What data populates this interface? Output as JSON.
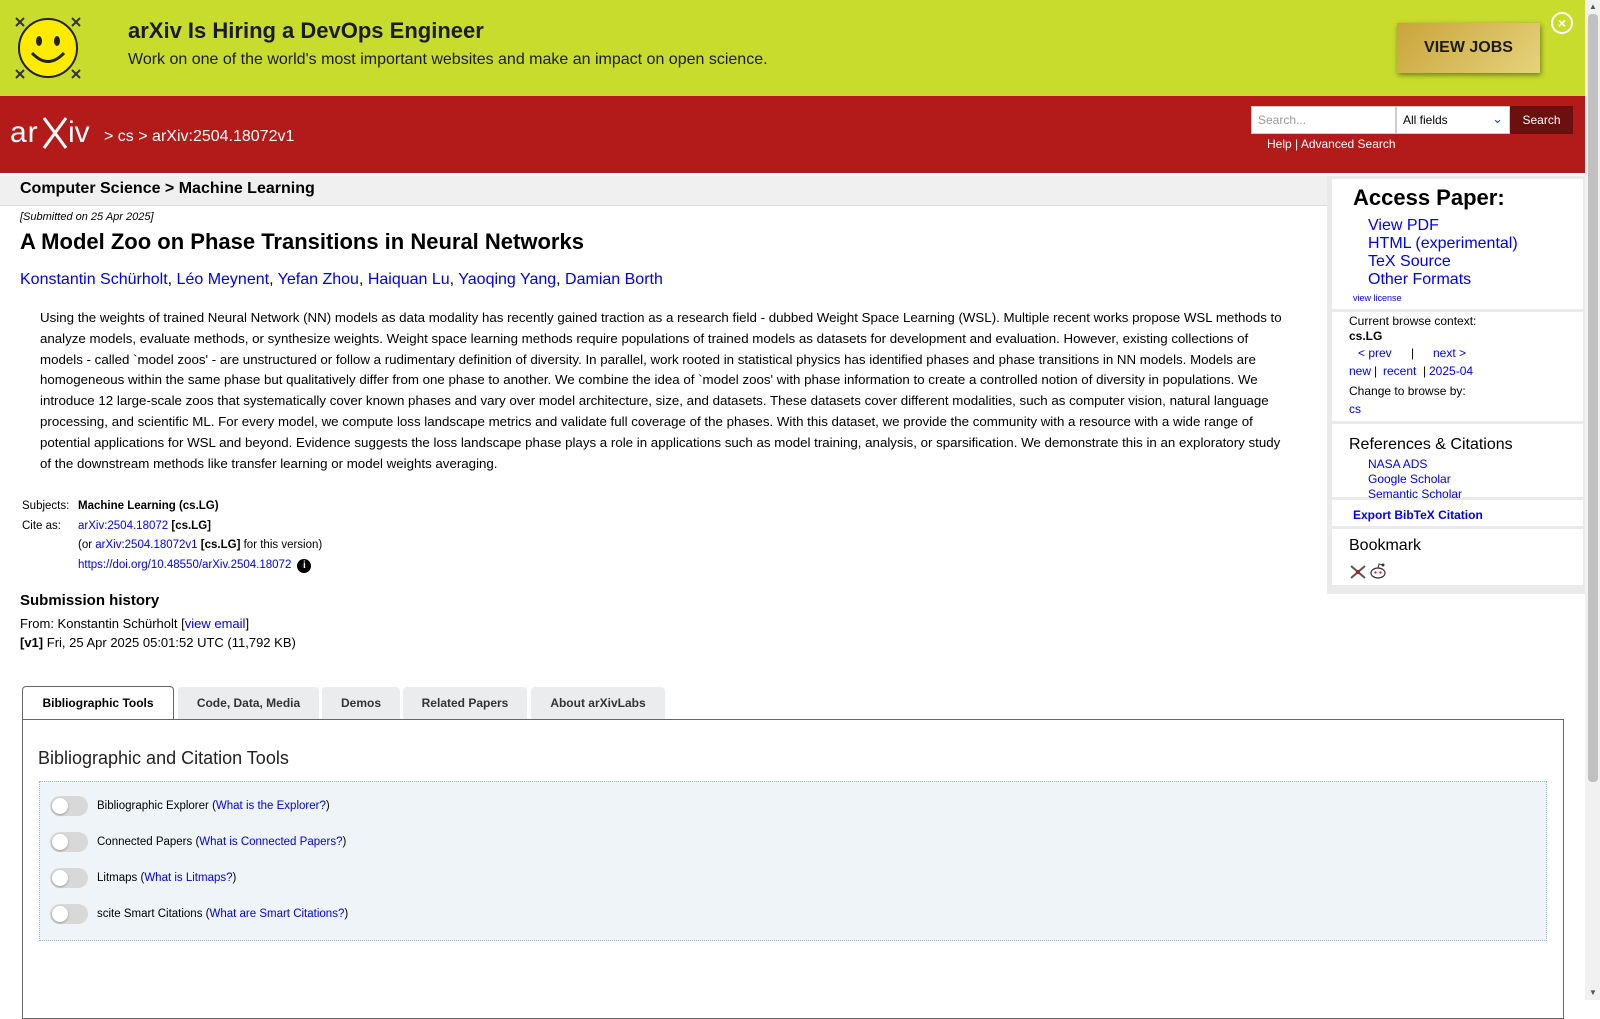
{
  "banner": {
    "title": "arXiv Is Hiring a DevOps Engineer",
    "subtitle": "Work on one of the world's most important websites and make an impact on open science.",
    "cta_label": "VIEW JOBS",
    "close_glyph": "×"
  },
  "header": {
    "logo_text": "arXiv",
    "crumb_sep1": ">",
    "crumb_cs": "cs",
    "crumb_sep2": ">",
    "crumb_id": "arXiv:2504.18072v1",
    "search_placeholder": "Search...",
    "search_field_value": "All fields",
    "search_button": "Search",
    "help_label": "Help",
    "help_sep": "|",
    "advanced_label": "Advanced Search"
  },
  "main": {
    "category": "Computer Science > Machine Learning",
    "submitted": "[Submitted on 25 Apr 2025]",
    "title": "A Model Zoo on Phase Transitions in Neural Networks",
    "authors": [
      "Konstantin Schürholt",
      "Léo Meynent",
      "Yefan Zhou",
      "Haiquan Lu",
      "Yaoqing Yang",
      "Damian Borth"
    ],
    "abstract": "Using the weights of trained Neural Network (NN) models as data modality has recently gained traction as a research field - dubbed Weight Space Learning (WSL). Multiple recent works propose WSL methods to analyze models, evaluate methods, or synthesize weights. Weight space learning methods require populations of trained models as datasets for development and evaluation. However, existing collections of models - called `model zoos' - are unstructured or follow a rudimentary definition of diversity. In parallel, work rooted in statistical physics has identified phases and phase transitions in NN models. Models are homogeneous within the same phase but qualitatively differ from one phase to another. We combine the idea of `model zoos' with phase information to create a controlled notion of diversity in populations. We introduce 12 large-scale zoos that systematically cover known phases and vary over model architecture, size, and datasets. These datasets cover different modalities, such as computer vision, natural language processing, and scientific ML. For every model, we compute loss landscape metrics and validate full coverage of the phases. With this dataset, we provide the community with a resource with a wide range of potential applications for WSL and beyond. Evidence suggests the loss landscape phase plays a role in applications such as model training, analysis, or sparsification. We demonstrate this in an exploratory study of the downstream methods like transfer learning or model weights averaging.",
    "subjects_label": "Subjects:",
    "subjects_value": "Machine Learning (cs.LG)",
    "cite_label": "Cite as:",
    "cite_id": "arXiv:2504.18072",
    "cite_tag": "[cs.LG]",
    "cite_or": "(or",
    "cite_version": "arXiv:2504.18072v1",
    "cite_version_tag": "[cs.LG]",
    "cite_for": "for this version)",
    "doi": "https://doi.org/10.48550/arXiv.2504.18072",
    "info_glyph": "i",
    "history_heading": "Submission history",
    "history_from": "From: Konstantin Schürholt [",
    "history_view_email": "view email",
    "history_close": "]",
    "history_v1_tag": "[v1]",
    "history_v1": "Fri, 25 Apr 2025 05:01:52 UTC (11,792 KB)"
  },
  "tabs": [
    {
      "label": "Bibliographic Tools"
    },
    {
      "label": "Code, Data, Media"
    },
    {
      "label": "Demos"
    },
    {
      "label": "Related Papers"
    },
    {
      "label": "About arXivLabs"
    }
  ],
  "panel": {
    "heading": "Bibliographic and Citation Tools",
    "tools": [
      {
        "name": "Bibliographic Explorer",
        "link": "What is the Explorer?"
      },
      {
        "name": "Connected Papers",
        "link": "What is Connected Papers?"
      },
      {
        "name": "Litmaps",
        "link": "What is Litmaps?"
      },
      {
        "name": "scite Smart Citations",
        "link": "What are Smart Citations?"
      }
    ]
  },
  "sidebar": {
    "access_heading": "Access Paper:",
    "access_links": [
      "View PDF",
      "HTML (experimental)",
      "TeX Source",
      "Other Formats"
    ],
    "view_license": "view license",
    "context_label": "Current browse context:",
    "context_value": "cs.LG",
    "prev": "< prev",
    "pipe": "|",
    "next": "next >",
    "new": "new",
    "recent": "recent",
    "month": "2025-04",
    "change_label": "Change to browse by:",
    "change_value": "cs",
    "refs_heading": "References & Citations",
    "refs_links": [
      "NASA ADS",
      "Google Scholar",
      "Semantic Scholar"
    ],
    "bibtex": "Export BibTeX Citation",
    "bookmark_heading": "Bookmark"
  },
  "colors": {
    "banner": "#c8dc2e",
    "header": "#b31b1b",
    "link": "#0000ee"
  }
}
